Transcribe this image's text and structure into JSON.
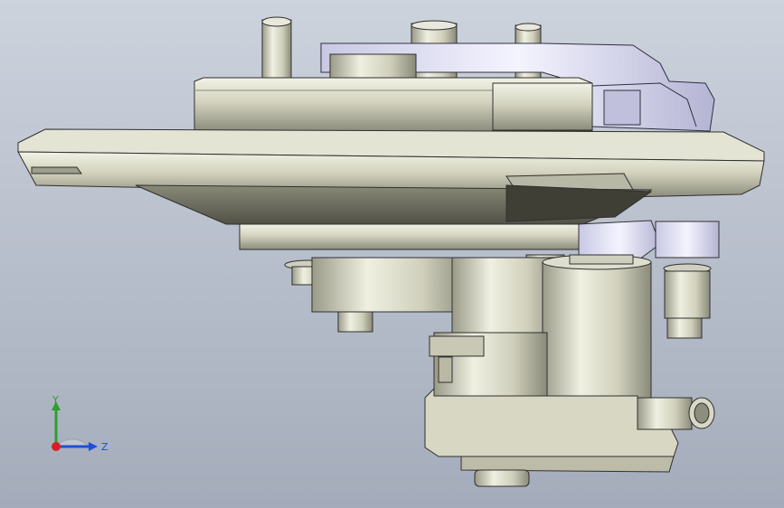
{
  "viewport": {
    "background_top": "#cdd3dd",
    "background_bottom": "#a4acbb"
  },
  "model": {
    "shell_color": "#d6d6c2",
    "shadow_color": "#6e6e60",
    "edge_color": "#303030",
    "plastic_color": "#dcdcf0"
  },
  "triad": {
    "y_label": "Y",
    "z_label": "Z",
    "y_color": "#2ca02c",
    "z_color": "#1f4fd8",
    "x_color": "#d62020"
  }
}
